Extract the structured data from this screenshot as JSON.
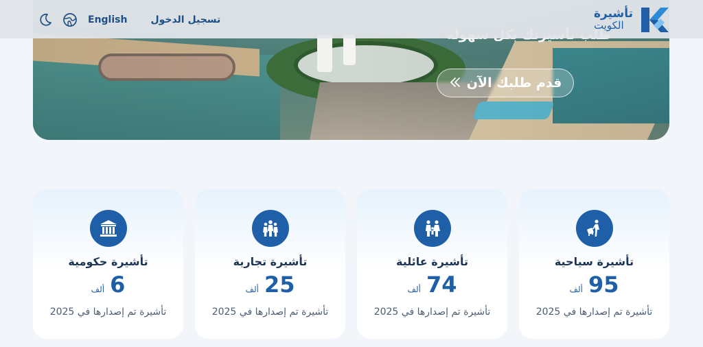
{
  "brand": {
    "line1": "تأشيرة",
    "line2": "الكويت"
  },
  "nav": {
    "language_label": "English",
    "login_label": "تسجيل الدخول",
    "globe_icon": "globe-icon",
    "theme_icon": "moon-icon"
  },
  "hero": {
    "heading_fragment": "طلب تأشيرتك بكل سهولة",
    "cta_label": "قدم طلبك الآن",
    "cta_icon": "double-chevron-icon"
  },
  "cards": [
    {
      "icon": "tourist-icon",
      "title": "تأشيرة سياحية",
      "value": "95",
      "unit": "ألف",
      "desc": "تأشيرة تم إصدارها في 2025"
    },
    {
      "icon": "family-icon",
      "title": "تأشيرة عائلية",
      "value": "74",
      "unit": "ألف",
      "desc": "تأشيرة تم إصدارها في 2025"
    },
    {
      "icon": "business-icon",
      "title": "تأشيرة تجارية",
      "value": "25",
      "unit": "ألف",
      "desc": "تأشيرة تم إصدارها في 2025"
    },
    {
      "icon": "government-icon",
      "title": "تأشيرة حكومية",
      "value": "6",
      "unit": "ألف",
      "desc": "تأشيرة تم إصدارها في 2025"
    }
  ],
  "colors": {
    "primary": "#1f5fa8",
    "background": "#f2f5fa",
    "text_dark": "#1c3556"
  }
}
